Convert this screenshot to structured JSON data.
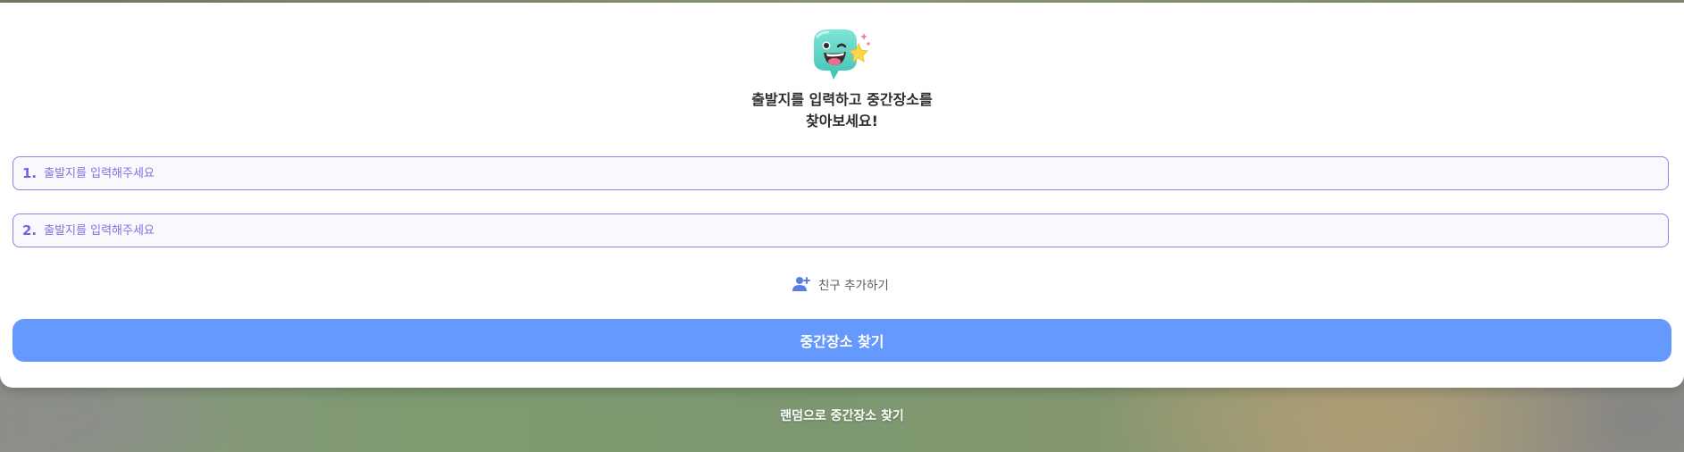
{
  "header": {
    "headline_line1": "출발지를 입력하고 중간장소를",
    "headline_line2": "찾아보세요!"
  },
  "inputs": [
    {
      "index_label": "1.",
      "placeholder": "출발지를 입력해주세요",
      "value": ""
    },
    {
      "index_label": "2.",
      "placeholder": "출발지를 입력해주세요",
      "value": ""
    }
  ],
  "add_friend": {
    "label": "친구 추가하기",
    "icon": "user-plus-icon"
  },
  "primary_button": {
    "label": "중간장소 찾기"
  },
  "random_link": {
    "label": "랜덤으로 중간장소 찾기"
  },
  "colors": {
    "accent": "#6599fd",
    "field_border": "#8b86e0",
    "field_text": "#6d66e0",
    "mascot_body": "#5fd6c8"
  }
}
